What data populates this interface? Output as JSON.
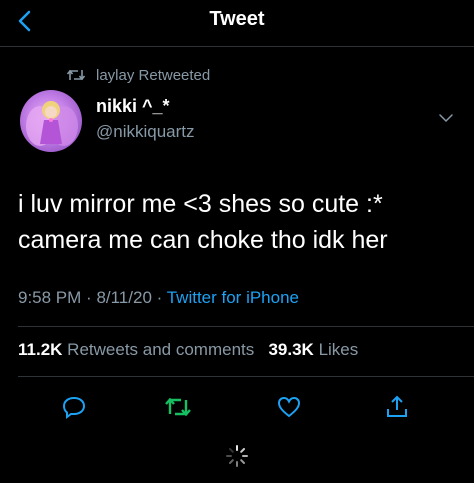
{
  "header": {
    "title": "Tweet",
    "back_icon": "chevron-left-icon"
  },
  "retweet_context": {
    "icon": "retweet-icon",
    "text": "laylay Retweeted"
  },
  "author": {
    "display_name": "nikki ^_*",
    "handle": "@nikkiquartz",
    "avatar": "avatar"
  },
  "tweet": {
    "lines": [
      "i luv mirror me <3 shes so cute :*",
      "camera me can choke tho idk her"
    ],
    "time": "9:58 PM",
    "date": "8/11/20",
    "source": "Twitter for iPhone"
  },
  "stats": {
    "retweets_count": "11.2K",
    "retweets_label": "Retweets and comments",
    "likes_count": "39.3K",
    "likes_label": "Likes"
  },
  "actions": [
    {
      "name": "reply-icon"
    },
    {
      "name": "retweet-icon"
    },
    {
      "name": "like-icon"
    },
    {
      "name": "share-icon"
    }
  ],
  "colors": {
    "accent": "#1da1f2",
    "retweet_active": "#17bf63",
    "muted": "#8899a6",
    "divider": "#2f3336",
    "background": "#000000"
  }
}
